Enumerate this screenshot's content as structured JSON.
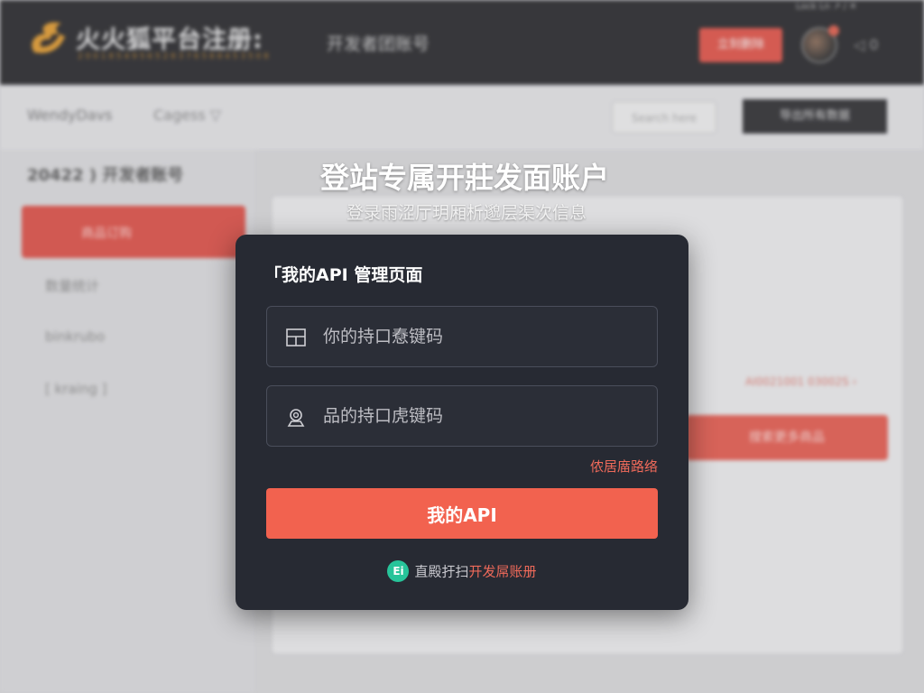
{
  "background": {
    "brand_title": "火火狐平台注册:",
    "brand_subtitle": "2 0 0 1 8 5 4 9 5 6 5 2 8 3 7 6 5 8 8 4 5 3 5 0 8",
    "page_label": "开发者团账号",
    "top_button": "立刻删除",
    "top_controls": "◁ 0",
    "top_note": "Lock Ln ↗ /   ✕",
    "breadcrumb_left": "WendyDavs",
    "breadcrumb_right": "Cagess ▽",
    "sub_search": "Search here",
    "sub_dark_button": "导出所有数据",
    "side_title": "20422 ) 开发者账号",
    "side_active": "商品订购",
    "side_items": [
      "数量统计",
      "binkrubo",
      "[ kraing ]"
    ],
    "content_red_link": "AI0021001 03002S ›",
    "content_red_button": "搜索更多商品"
  },
  "overlay": {
    "title": "登站专属开莊发面账户",
    "subtitle": "登录雨涩厅玥厢析邈层渠次信息"
  },
  "modal": {
    "title": "「我的API  管理页面",
    "username_placeholder": "你的持口憃键码",
    "password_placeholder": "品的持口虎键码",
    "forgot_link": "侬居庿路络",
    "submit_label": "我的API",
    "footer_badge": "Ei",
    "footer_text": "直殿扜扫",
    "footer_link": "开发屌账册"
  },
  "colors": {
    "accent": "#f2624f",
    "modal_bg": "#272a33",
    "badge_green": "#27c49a"
  },
  "icons": {
    "logo": "flame-logo-icon",
    "username": "layout-icon",
    "password": "user-badge-icon"
  }
}
